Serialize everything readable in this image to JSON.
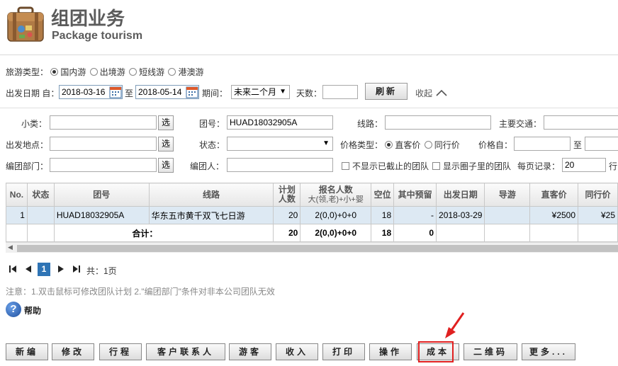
{
  "header": {
    "title_cn": "组团业务",
    "title_en": "Package tourism"
  },
  "filter": {
    "tour_type_label": "旅游类型：",
    "tour_types": [
      "国内游",
      "出境游",
      "短线游",
      "港澳游"
    ],
    "depart_label": "出发日期 自：",
    "date_from": "2018-03-16",
    "to_label": "至",
    "date_to": "2018-05-14",
    "period_label": "期间：",
    "period_value": "未来二个月",
    "days_label": "天数：",
    "days_value": "",
    "refresh": "刷新",
    "collapse": "收起"
  },
  "adv": {
    "subcat_label": "小类：",
    "subcat": "",
    "select_btn": "选",
    "group_no_label": "团号：",
    "group_no": "HUAD18032905A",
    "route_label": "线路：",
    "route": "",
    "transport_label": "主要交通：",
    "transport": "",
    "depart_place_label": "出发地点：",
    "depart_place": "",
    "status_label": "状态：",
    "status_value": "",
    "price_type_label": "价格类型：",
    "price_types": [
      "直客价",
      "同行价"
    ],
    "price_from_label": "价格自：",
    "price_from": "",
    "price_to_label": "至",
    "price_to": "",
    "dept_label": "编团部门：",
    "dept": "",
    "creator_label": "编团人：",
    "creator": "",
    "hide_closed": "不显示已截止的团队",
    "show_circle": "显示圈子里的团队",
    "per_page_label": "每页记录：",
    "per_page": "20",
    "row_suffix": "行"
  },
  "table": {
    "headers": [
      "No.",
      "状态",
      "团号",
      "线路",
      "计划人数",
      "报名人数",
      "大(领,老)+小+婴",
      "空位",
      "其中预留",
      "出发日期",
      "导游",
      "直客价",
      "同行价"
    ],
    "plan_h1": "计划",
    "plan_h2": "人数",
    "rows": [
      {
        "no": "1",
        "status": "",
        "group": "HUAD18032905A",
        "route": "华东五市黄千双飞七日游",
        "plan": "20",
        "signed": "2(0,0)+0+0",
        "vacant": "18",
        "reserved": "-",
        "date": "2018-03-29",
        "guide": "",
        "direct": "¥2500",
        "peer": "¥25"
      }
    ],
    "total": {
      "label": "合计：",
      "plan": "20",
      "signed": "2(0,0)+0+0",
      "vacant": "18",
      "reserved": "0"
    }
  },
  "pager": {
    "current": "1",
    "summary": "共：1页"
  },
  "note": "注意：1.双击鼠标可修改团队计划   2.\"编团部门\"条件对非本公司团队无效",
  "help": "帮助",
  "actions": [
    "新编",
    "修改",
    "行程",
    "客户联系人",
    "游客",
    "收入",
    "打印",
    "操作",
    "成本",
    "二维码",
    "更多..."
  ]
}
